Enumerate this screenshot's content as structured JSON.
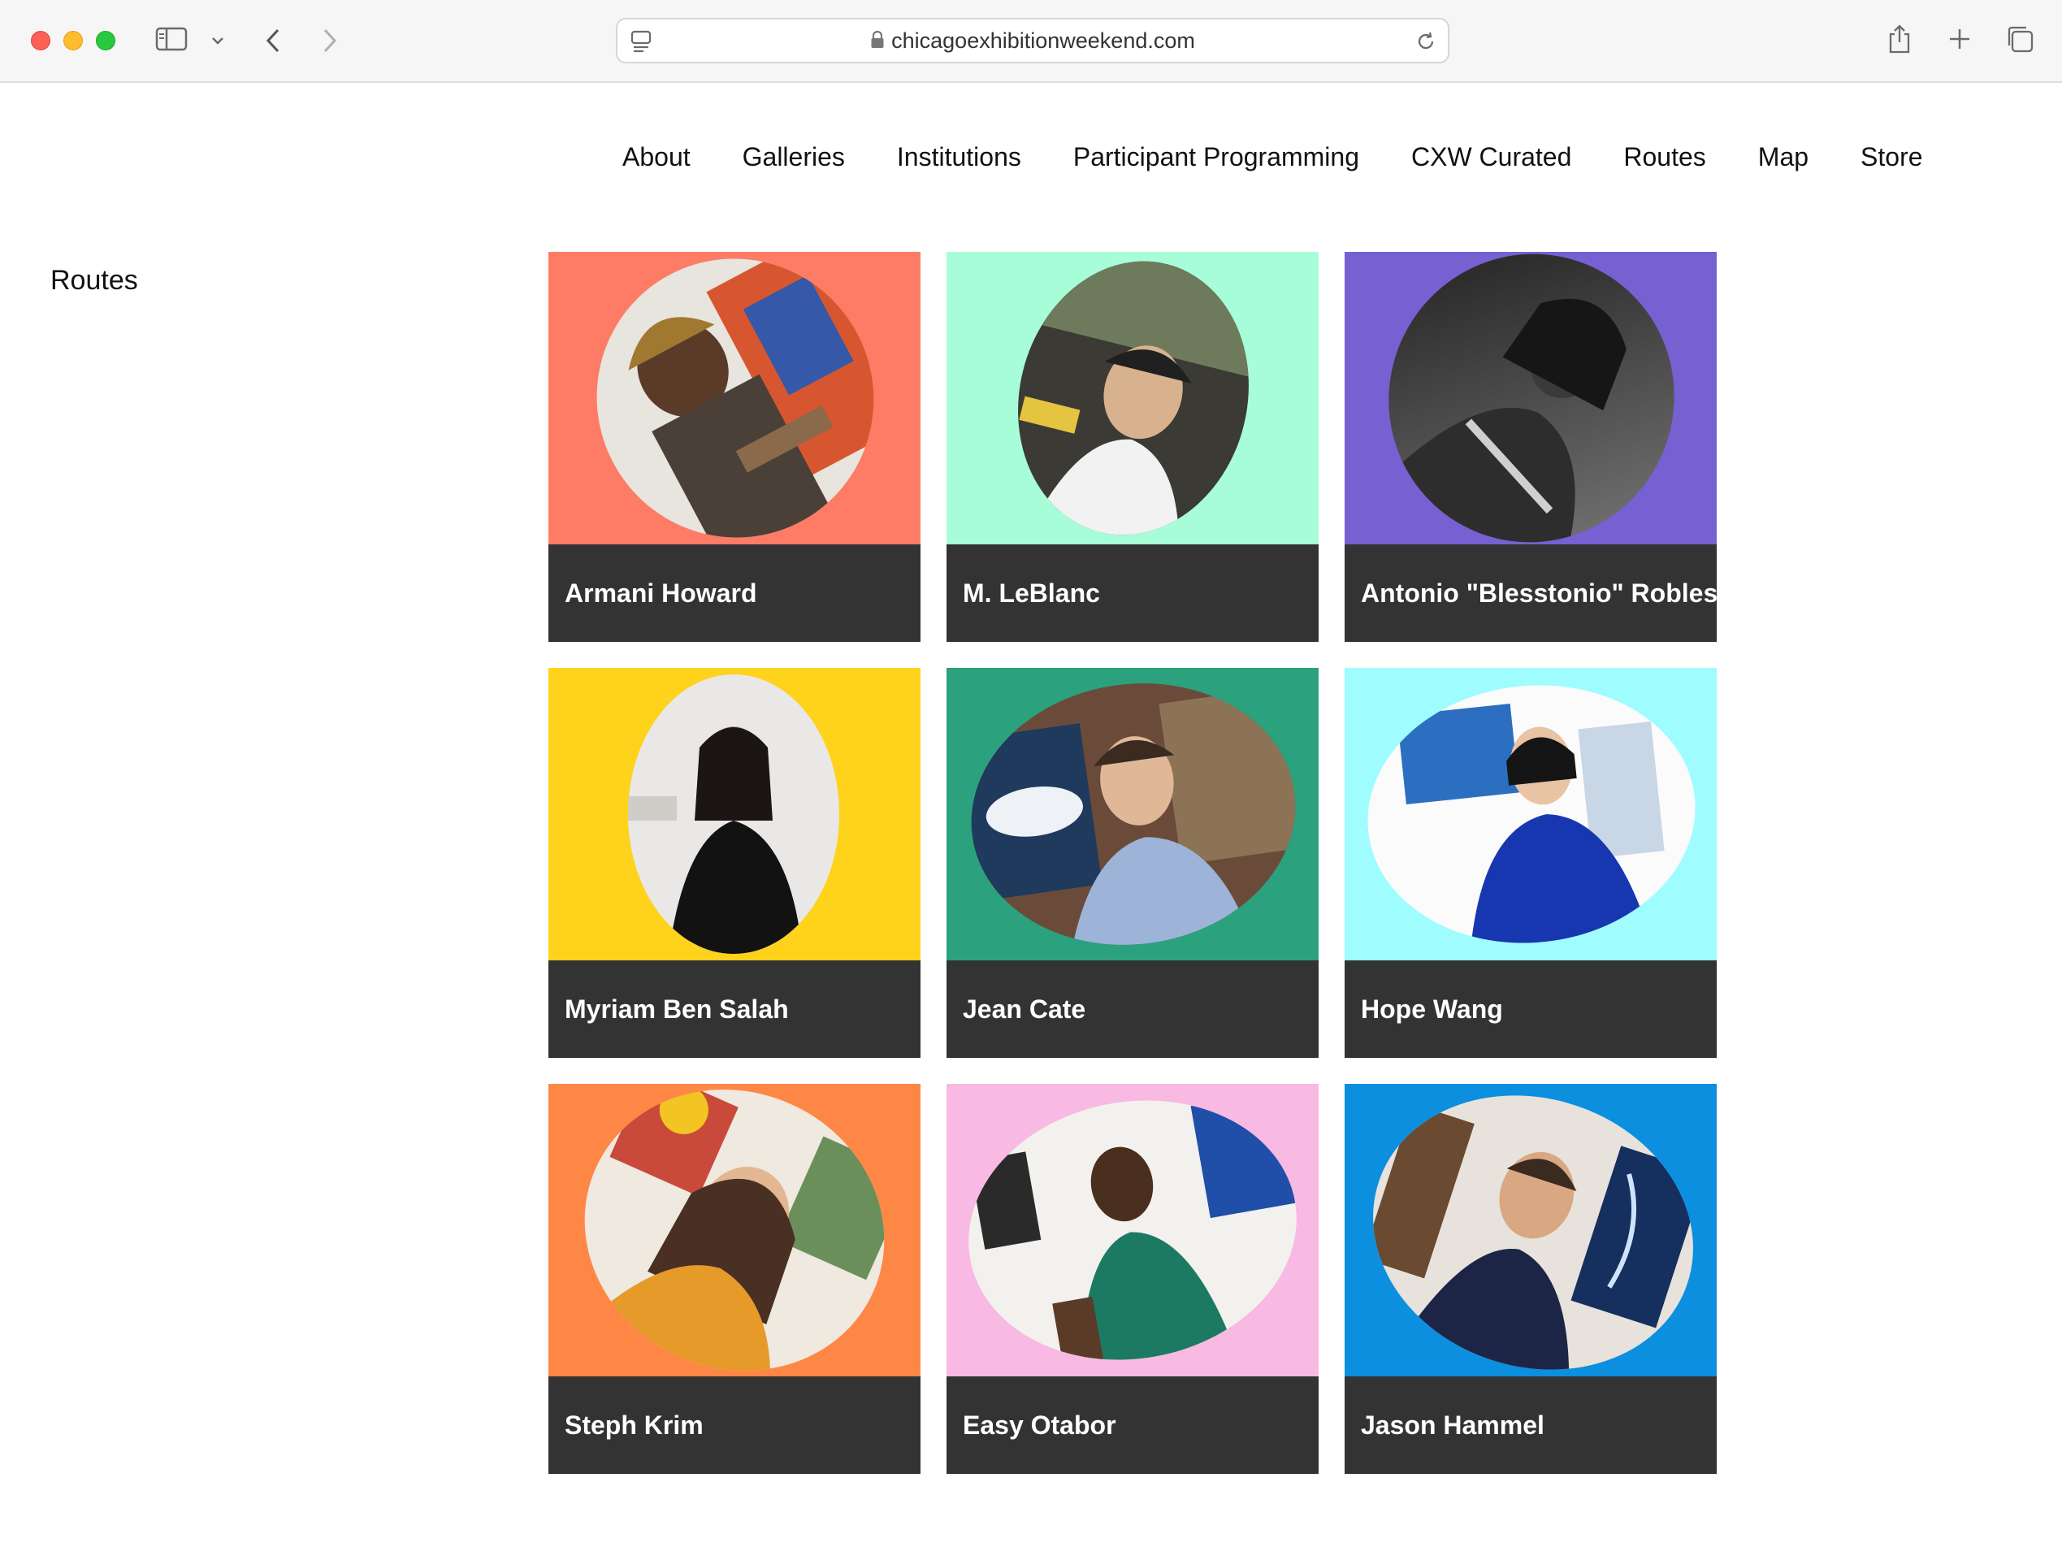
{
  "browser": {
    "url": "chicagoexhibitionweekend.com"
  },
  "nav": {
    "items": [
      {
        "label": "About"
      },
      {
        "label": "Galleries"
      },
      {
        "label": "Institutions"
      },
      {
        "label": "Participant Programming"
      },
      {
        "label": "CXW Curated"
      },
      {
        "label": "Routes"
      },
      {
        "label": "Map"
      },
      {
        "label": "Store"
      }
    ]
  },
  "sidebar": {
    "title": "Routes"
  },
  "cards": [
    {
      "name": "Armani Howard",
      "bg": "#fe7b66"
    },
    {
      "name": "M. LeBlanc",
      "bg": "#a8fdd9"
    },
    {
      "name": "Antonio \"Blesstonio\" Robles",
      "bg": "#7660d2"
    },
    {
      "name": "Myriam Ben Salah",
      "bg": "#ffd21c"
    },
    {
      "name": "Jean Cate",
      "bg": "#2ca17d"
    },
    {
      "name": "Hope Wang",
      "bg": "#9ffcff"
    },
    {
      "name": "Steph Krim",
      "bg": "#ff8745"
    },
    {
      "name": "Easy Otabor",
      "bg": "#f8b9e2"
    },
    {
      "name": "Jason Hammel",
      "bg": "#0c8fdf"
    }
  ]
}
